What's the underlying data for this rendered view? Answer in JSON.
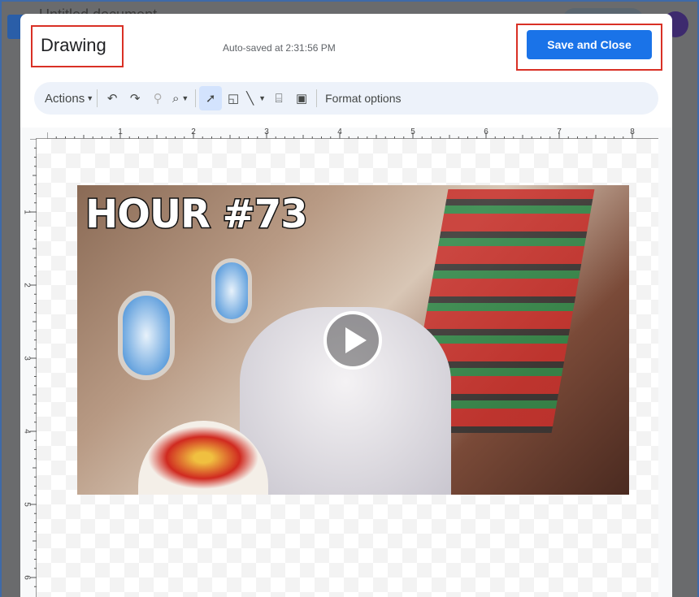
{
  "background": {
    "doc_title": "Untitled document"
  },
  "dialog": {
    "title": "Drawing",
    "autosave": "Auto-saved at 2:31:56 PM",
    "save_button": "Save and Close"
  },
  "toolbar": {
    "actions": "Actions",
    "format_options": "Format options",
    "icons": [
      "undo-icon",
      "redo-icon",
      "paint-format-icon",
      "zoom-icon",
      "select-icon",
      "shape-icon",
      "line-icon",
      "text-box-icon",
      "image-icon"
    ]
  },
  "rulers": {
    "horizontal": [
      "1",
      "2",
      "3",
      "4",
      "5",
      "6",
      "7",
      "8"
    ],
    "vertical": [
      "1",
      "2",
      "3",
      "4",
      "5",
      "6"
    ]
  },
  "image": {
    "overlay_text": "HOUR #73",
    "has_play_button": true
  }
}
